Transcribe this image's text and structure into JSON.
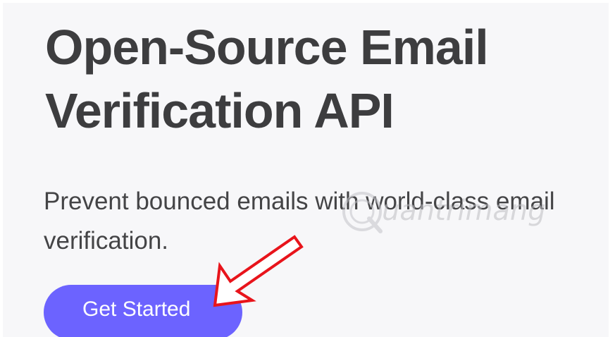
{
  "hero": {
    "title_line1": "Open-Source Email",
    "title_line2": "Verification API",
    "subtitle_line1": "Prevent bounced emails with world-class email",
    "subtitle_line2": "verification.",
    "cta_label": "Get Started"
  },
  "watermark": {
    "text": "uantrimang",
    "icon": "q-logo-icon"
  },
  "annotation": {
    "icon": "red-arrow-icon"
  },
  "colors": {
    "background": "#f7f7f9",
    "title": "#3d3d3f",
    "cta_background": "#6c63ff",
    "cta_text": "#ffffff",
    "arrow": "#e8141b"
  }
}
